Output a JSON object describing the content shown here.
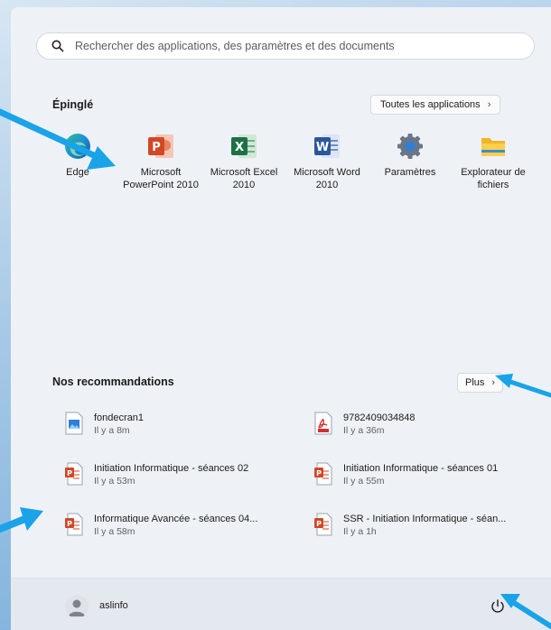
{
  "search": {
    "placeholder": "Rechercher des applications, des paramètres et des documents"
  },
  "pinned": {
    "title": "Épinglé",
    "all_apps_label": "Toutes les applications",
    "apps": [
      {
        "label": "Edge",
        "icon": "edge-icon"
      },
      {
        "label": "Microsoft PowerPoint 2010",
        "icon": "powerpoint-icon"
      },
      {
        "label": "Microsoft Excel 2010",
        "icon": "excel-icon"
      },
      {
        "label": "Microsoft Word 2010",
        "icon": "word-icon"
      },
      {
        "label": "Paramètres",
        "icon": "settings-icon"
      },
      {
        "label": "Explorateur de fichiers",
        "icon": "folder-icon"
      }
    ]
  },
  "recommended": {
    "title": "Nos recommandations",
    "more_label": "Plus",
    "items": [
      {
        "name": "fondecran1",
        "time": "Il y a 8m",
        "icon": "image-file-icon"
      },
      {
        "name": "9782409034848",
        "time": "Il y a 36m",
        "icon": "pdf-file-icon"
      },
      {
        "name": "Initiation Informatique - séances 02",
        "time": "Il y a 53m",
        "icon": "powerpoint-file-icon"
      },
      {
        "name": "Initiation Informatique - séances 01",
        "time": "Il y a 55m",
        "icon": "powerpoint-file-icon"
      },
      {
        "name": "Informatique Avancée - séances 04...",
        "time": "Il y a 58m",
        "icon": "powerpoint-file-icon"
      },
      {
        "name": "SSR - Initiation Informatique - séan...",
        "time": "Il y a 1h",
        "icon": "powerpoint-file-icon"
      }
    ]
  },
  "user": {
    "name": "aslinfo"
  },
  "colors": {
    "accent_arrow": "#1aa3e8",
    "powerpoint": "#d24726",
    "excel": "#1e7145",
    "word": "#2b579a"
  }
}
